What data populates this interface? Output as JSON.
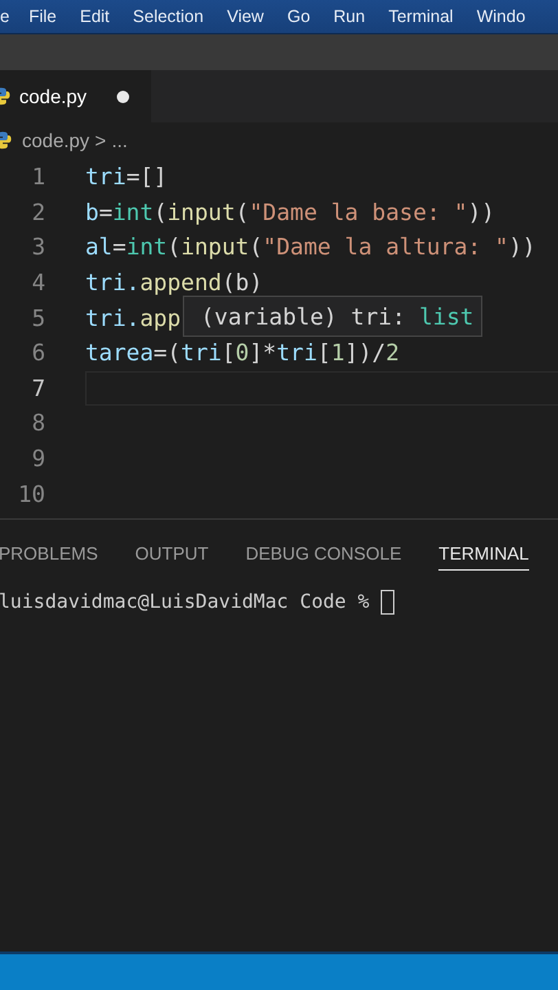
{
  "menu_bar": {
    "items": [
      "e",
      "File",
      "Edit",
      "Selection",
      "View",
      "Go",
      "Run",
      "Terminal",
      "Windo"
    ]
  },
  "tabs": [
    {
      "label": "code.py",
      "selected": true,
      "modified": true
    }
  ],
  "breadcrumb": {
    "file": "code.py",
    "separator": ">",
    "more": "..."
  },
  "editor": {
    "lines": [
      {
        "number": "1",
        "current": false,
        "tokens": [
          {
            "text": "tri",
            "kind": "var"
          },
          {
            "text": "=[]",
            "kind": "plain"
          }
        ]
      },
      {
        "number": "2",
        "current": false,
        "tokens": [
          {
            "text": "b",
            "kind": "var"
          },
          {
            "text": "=",
            "kind": "plain"
          },
          {
            "text": "int",
            "kind": "type"
          },
          {
            "text": "(",
            "kind": "plain"
          },
          {
            "text": "input",
            "kind": "func"
          },
          {
            "text": "(",
            "kind": "plain"
          },
          {
            "text": "\"Dame la base: \"",
            "kind": "string"
          },
          {
            "text": "))",
            "kind": "plain"
          }
        ]
      },
      {
        "number": "3",
        "current": false,
        "tokens": [
          {
            "text": "al",
            "kind": "var"
          },
          {
            "text": "=",
            "kind": "plain"
          },
          {
            "text": "int",
            "kind": "type"
          },
          {
            "text": "(",
            "kind": "plain"
          },
          {
            "text": "input",
            "kind": "func"
          },
          {
            "text": "(",
            "kind": "plain"
          },
          {
            "text": "\"Dame la altura: \"",
            "kind": "string"
          },
          {
            "text": "))",
            "kind": "plain"
          }
        ]
      },
      {
        "number": "4",
        "current": false,
        "tokens": [
          {
            "text": "tri.",
            "kind": "var"
          },
          {
            "text": "append",
            "kind": "func"
          },
          {
            "text": "(b)",
            "kind": "plain"
          }
        ]
      },
      {
        "number": "5",
        "current": false,
        "tokens": [
          {
            "text": "tri.",
            "kind": "var"
          },
          {
            "text": "app",
            "kind": "func"
          }
        ]
      },
      {
        "number": "6",
        "current": false,
        "tokens": [
          {
            "text": "tarea",
            "kind": "var"
          },
          {
            "text": "=(",
            "kind": "plain"
          },
          {
            "text": "tri",
            "kind": "var"
          },
          {
            "text": "[",
            "kind": "plain"
          },
          {
            "text": "0",
            "kind": "number"
          },
          {
            "text": "]*",
            "kind": "plain"
          },
          {
            "text": "tri",
            "kind": "var"
          },
          {
            "text": "[",
            "kind": "plain"
          },
          {
            "text": "1",
            "kind": "number"
          },
          {
            "text": "])/",
            "kind": "plain"
          },
          {
            "text": "2",
            "kind": "number"
          }
        ]
      },
      {
        "number": "7",
        "current": true
      },
      {
        "number": "8",
        "current": false
      },
      {
        "number": "9",
        "current": false
      },
      {
        "number": "10",
        "current": false
      }
    ],
    "hover_tooltip": {
      "prefix": "(variable) tri: ",
      "type": "list"
    }
  },
  "panel": {
    "tabs": [
      {
        "label": "PROBLEMS",
        "selected": false
      },
      {
        "label": "OUTPUT",
        "selected": false
      },
      {
        "label": "DEBUG CONSOLE",
        "selected": false
      },
      {
        "label": "TERMINAL",
        "selected": true
      }
    ],
    "terminal": {
      "prompt": "luisdavidmac@LuisDavidMac Code %"
    }
  }
}
